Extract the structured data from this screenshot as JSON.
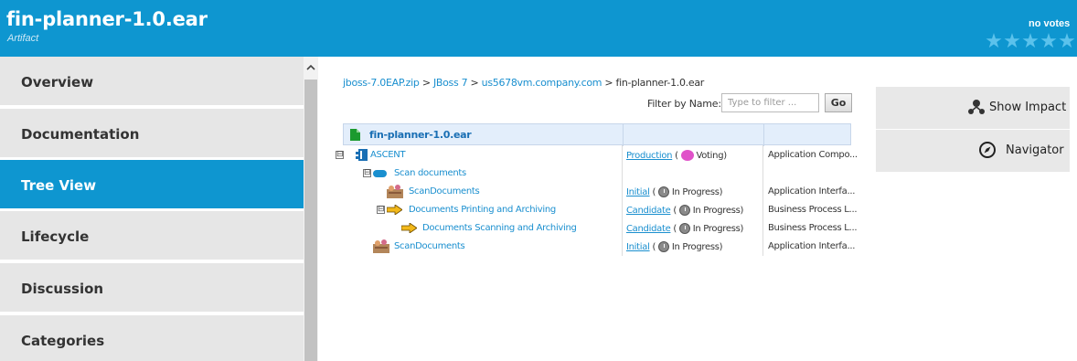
{
  "header": {
    "title": "fin-planner-1.0.ear",
    "subtitle": "Artifact",
    "votes_label": "no votes",
    "rating_stars": 5
  },
  "nav": {
    "items": [
      {
        "label": "Overview"
      },
      {
        "label": "Documentation"
      },
      {
        "label": "Tree View"
      },
      {
        "label": "Lifecycle"
      },
      {
        "label": "Discussion"
      },
      {
        "label": "Categories"
      }
    ]
  },
  "breadcrumb": {
    "links": [
      "jboss-7.0EAP.zip",
      "JBoss 7",
      "us5678vm.company.com"
    ],
    "current": "fin-planner-1.0.ear",
    "separator": ">"
  },
  "filter": {
    "label": "Filter by Name:",
    "placeholder": "Type to filter ...",
    "go_label": "Go"
  },
  "actions": {
    "show_impact": "Show Impact",
    "navigator": "Navigator"
  },
  "tree": {
    "root_name": "fin-planner-1.0.ear",
    "rows": [
      {
        "name": "ASCENT",
        "toggle": "⊟",
        "icon": "app-component-icon",
        "stage": "Production",
        "state": "Voting",
        "state_icon": "voting-icon",
        "type": "Application Compo..."
      },
      {
        "name": "Scan documents",
        "toggle": "⊟",
        "icon": "interface-icon",
        "stage": "",
        "state": "",
        "state_icon": "",
        "type": ""
      },
      {
        "name": "ScanDocuments",
        "toggle": "",
        "icon": "operation-icon",
        "stage": "Initial",
        "state": "In Progress",
        "state_icon": "clock-icon",
        "type": "Application Interfa..."
      },
      {
        "name": "Documents Printing and Archiving",
        "toggle": "⊟",
        "icon": "process-arrow-icon",
        "stage": "Candidate",
        "state": "In Progress",
        "state_icon": "clock-icon",
        "type": "Business Process L..."
      },
      {
        "name": "Documents Scanning and Archiving",
        "toggle": "",
        "icon": "process-arrow-icon",
        "stage": "Candidate",
        "state": "In Progress",
        "state_icon": "clock-icon",
        "type": "Business Process L..."
      },
      {
        "name": "ScanDocuments",
        "toggle": "",
        "icon": "operation-icon",
        "stage": "Initial",
        "state": "In Progress",
        "state_icon": "clock-icon",
        "type": "Application Interfa..."
      }
    ]
  },
  "colors": {
    "brand": "#0e96d0",
    "link": "#1a8fcf",
    "nav_bg": "#e6e6e6",
    "star": "#5bc2ec"
  }
}
